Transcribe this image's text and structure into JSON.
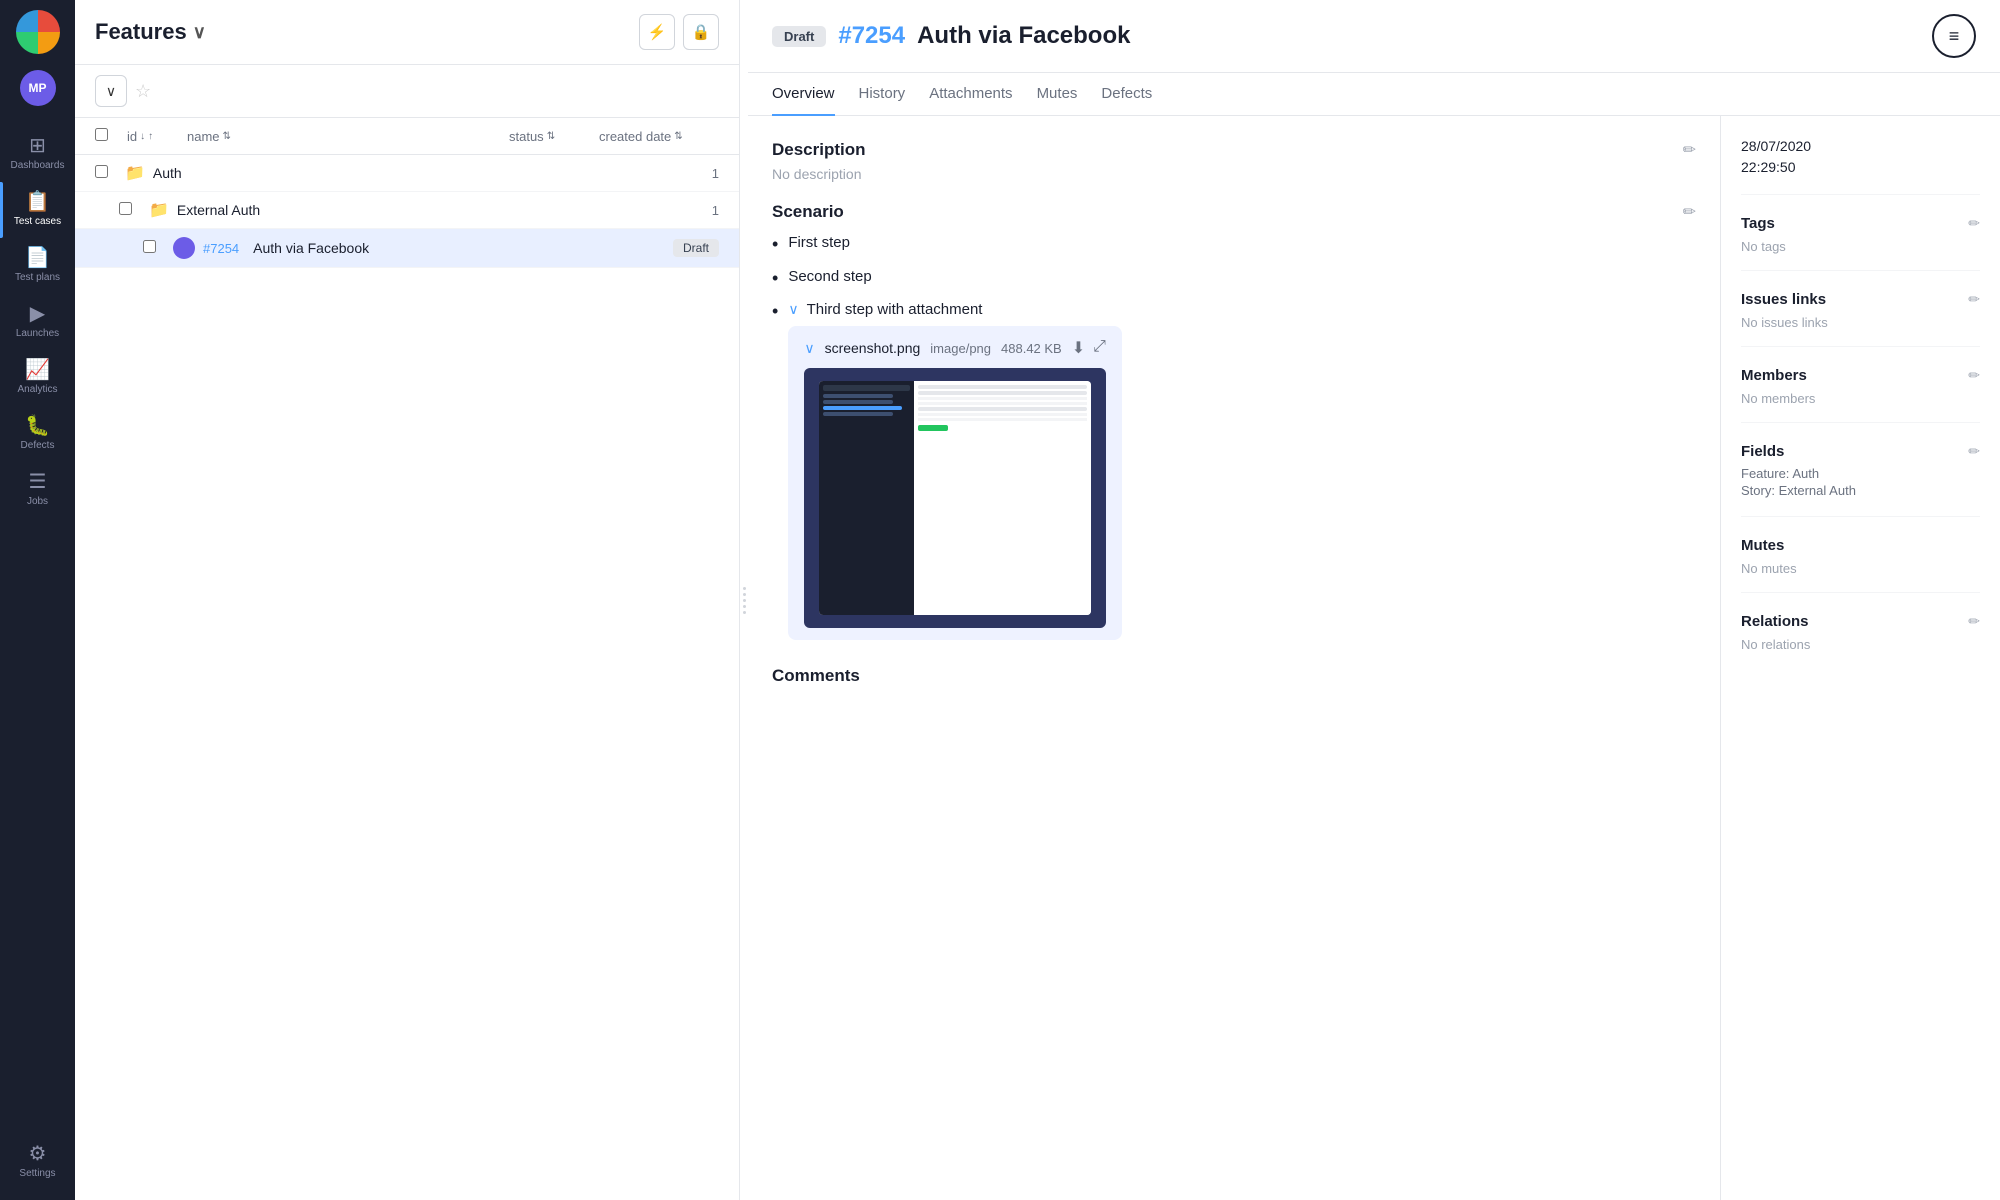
{
  "app": {
    "logo_initials": "MP"
  },
  "sidebar": {
    "items": [
      {
        "id": "dashboards",
        "label": "Dashboards",
        "icon": "▦",
        "active": false
      },
      {
        "id": "test-cases",
        "label": "Test cases",
        "icon": "≡",
        "active": true
      },
      {
        "id": "test-plans",
        "label": "Test plans",
        "icon": "☰",
        "active": false
      },
      {
        "id": "launches",
        "label": "Launches",
        "icon": "▶",
        "active": false
      },
      {
        "id": "analytics",
        "label": "Analytics",
        "icon": "📊",
        "active": false
      },
      {
        "id": "defects",
        "label": "Defects",
        "icon": "🐞",
        "active": false
      },
      {
        "id": "jobs",
        "label": "Jobs",
        "icon": "▤",
        "active": false
      },
      {
        "id": "settings",
        "label": "Settings",
        "icon": "⚙",
        "active": false
      }
    ]
  },
  "left_panel": {
    "title": "Features",
    "filter_tooltip": "Filter",
    "lock_tooltip": "Lock",
    "columns": {
      "id": "id",
      "name": "name",
      "status": "status",
      "created_date": "created date"
    },
    "rows": [
      {
        "type": "group",
        "name": "Auth",
        "count": "1",
        "indent": 0
      },
      {
        "type": "subgroup",
        "name": "External Auth",
        "count": "1",
        "indent": 1
      },
      {
        "type": "test",
        "id": "#7254",
        "name": "Auth via Facebook",
        "status": "Draft",
        "indent": 2,
        "selected": true
      }
    ]
  },
  "right_panel": {
    "issue": {
      "status": "Draft",
      "id": "#7254",
      "title": "Auth via Facebook"
    },
    "tabs": [
      {
        "id": "overview",
        "label": "Overview",
        "active": true
      },
      {
        "id": "history",
        "label": "History",
        "active": false
      },
      {
        "id": "attachments",
        "label": "Attachments",
        "active": false
      },
      {
        "id": "mutes",
        "label": "Mutes",
        "active": false
      },
      {
        "id": "defects",
        "label": "Defects",
        "active": false
      }
    ],
    "description": {
      "title": "Description",
      "value": "No description"
    },
    "scenario": {
      "title": "Scenario",
      "steps": [
        {
          "text": "First step",
          "expandable": false
        },
        {
          "text": "Second step",
          "expandable": false
        },
        {
          "text": "Third step with attachment",
          "expandable": true,
          "expanded": true
        }
      ],
      "attachment": {
        "name": "screenshot.png",
        "type": "image/png",
        "size": "488.42 KB",
        "toggle_label": "∨"
      }
    },
    "comments": {
      "title": "Comments"
    }
  },
  "right_sidebar": {
    "date": "28/07/2020\n22:29:50",
    "tags": {
      "title": "Tags",
      "value": "No tags"
    },
    "issues_links": {
      "title": "Issues links",
      "value": "No issues links"
    },
    "members": {
      "title": "Members",
      "value": "No members"
    },
    "fields": {
      "title": "Fields",
      "feature_label": "Feature:",
      "feature_value": "Auth",
      "story_label": "Story:",
      "story_value": "External Auth"
    },
    "mutes": {
      "title": "Mutes",
      "value": "No mutes"
    },
    "relations": {
      "title": "Relations",
      "value": "No relations"
    }
  }
}
